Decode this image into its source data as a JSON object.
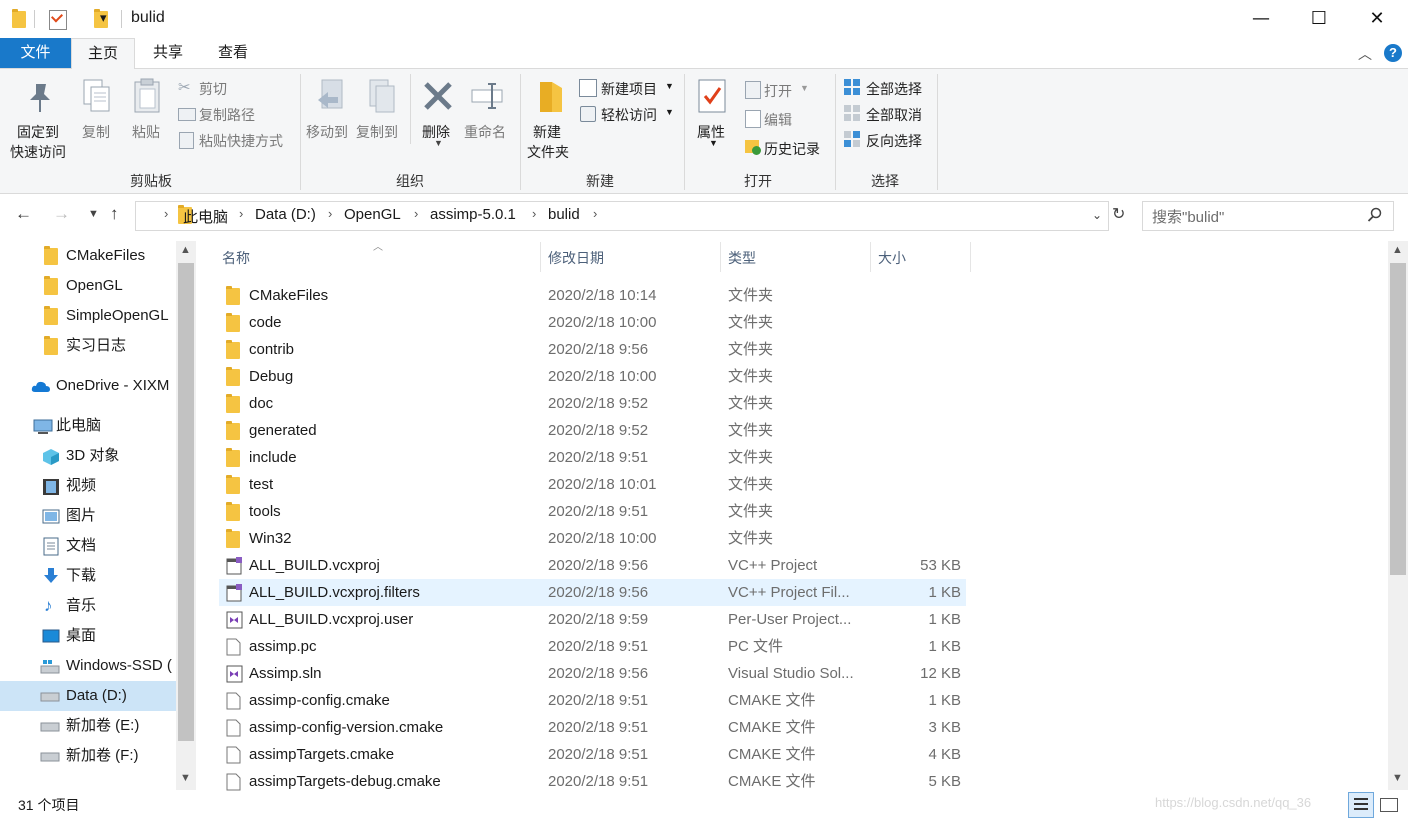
{
  "window": {
    "title": "bulid",
    "minimize": "—",
    "maximize": "☐",
    "close": "✕",
    "quick_access_dropdown": "▾"
  },
  "ribbon_tabs": [
    {
      "label": "文件"
    },
    {
      "label": "主页"
    },
    {
      "label": "共享"
    },
    {
      "label": "查看"
    }
  ],
  "ribbon": {
    "clipboard": {
      "pin_label_1": "固定到",
      "pin_label_2": "快速访问",
      "copy": "复制",
      "paste": "粘贴",
      "cut": "剪切",
      "copy_path": "复制路径",
      "paste_shortcut": "粘贴快捷方式",
      "group": "剪贴板"
    },
    "organize": {
      "move_to": "移动到",
      "copy_to": "复制到",
      "delete": "删除",
      "rename": "重命名",
      "group": "组织"
    },
    "new": {
      "new_folder_1": "新建",
      "new_folder_2": "文件夹",
      "new_item": "新建项目",
      "easy_access": "轻松访问",
      "group": "新建"
    },
    "open": {
      "properties": "属性",
      "open": "打开",
      "edit": "编辑",
      "history": "历史记录",
      "group": "打开"
    },
    "select": {
      "select_all": "全部选择",
      "select_none": "全部取消",
      "invert": "反向选择",
      "group": "选择"
    }
  },
  "address": {
    "crumbs": [
      "此电脑",
      "Data (D:)",
      "OpenGL",
      "assimp-5.0.1",
      "bulid"
    ],
    "search_placeholder": "搜索\"bulid\""
  },
  "nav": [
    {
      "label": "CMakeFiles",
      "icon": "folder-icon"
    },
    {
      "label": "OpenGL",
      "icon": "folder-icon"
    },
    {
      "label": "SimpleOpenGL",
      "icon": "folder-icon"
    },
    {
      "label": "实习日志",
      "icon": "folder-icon"
    },
    {
      "label": "OneDrive - XIXM",
      "icon": "onedrive-icon"
    },
    {
      "label": "此电脑",
      "icon": "pc-icon"
    },
    {
      "label": "3D 对象",
      "icon": "3d-objects-icon"
    },
    {
      "label": "视频",
      "icon": "video-icon"
    },
    {
      "label": "图片",
      "icon": "pictures-icon"
    },
    {
      "label": "文档",
      "icon": "documents-icon"
    },
    {
      "label": "下载",
      "icon": "download-icon"
    },
    {
      "label": "音乐",
      "icon": "music-icon"
    },
    {
      "label": "桌面",
      "icon": "desktop-icon"
    },
    {
      "label": "Windows-SSD (",
      "icon": "windows-drive-icon"
    },
    {
      "label": "Data (D:)",
      "icon": "drive-icon"
    },
    {
      "label": "新加卷 (E:)",
      "icon": "drive-icon"
    },
    {
      "label": "新加卷 (F:)",
      "icon": "drive-icon"
    }
  ],
  "columns": {
    "name": "名称",
    "date": "修改日期",
    "type": "类型",
    "size": "大小"
  },
  "files": [
    {
      "name": "CMakeFiles",
      "date": "2020/2/18 10:14",
      "type": "文件夹",
      "size": "",
      "icon": "folder-icon"
    },
    {
      "name": "code",
      "date": "2020/2/18 10:00",
      "type": "文件夹",
      "size": "",
      "icon": "folder-icon"
    },
    {
      "name": "contrib",
      "date": "2020/2/18 9:56",
      "type": "文件夹",
      "size": "",
      "icon": "folder-icon"
    },
    {
      "name": "Debug",
      "date": "2020/2/18 10:00",
      "type": "文件夹",
      "size": "",
      "icon": "folder-icon"
    },
    {
      "name": "doc",
      "date": "2020/2/18 9:52",
      "type": "文件夹",
      "size": "",
      "icon": "folder-icon"
    },
    {
      "name": "generated",
      "date": "2020/2/18 9:52",
      "type": "文件夹",
      "size": "",
      "icon": "folder-icon"
    },
    {
      "name": "include",
      "date": "2020/2/18 9:51",
      "type": "文件夹",
      "size": "",
      "icon": "folder-icon"
    },
    {
      "name": "test",
      "date": "2020/2/18 10:01",
      "type": "文件夹",
      "size": "",
      "icon": "folder-icon"
    },
    {
      "name": "tools",
      "date": "2020/2/18 9:51",
      "type": "文件夹",
      "size": "",
      "icon": "folder-icon"
    },
    {
      "name": "Win32",
      "date": "2020/2/18 10:00",
      "type": "文件夹",
      "size": "",
      "icon": "folder-icon"
    },
    {
      "name": "ALL_BUILD.vcxproj",
      "date": "2020/2/18 9:56",
      "type": "VC++ Project",
      "size": "53 KB",
      "icon": "vcxproj-icon"
    },
    {
      "name": "ALL_BUILD.vcxproj.filters",
      "date": "2020/2/18 9:56",
      "type": "VC++ Project Fil...",
      "size": "1 KB",
      "icon": "filters-icon"
    },
    {
      "name": "ALL_BUILD.vcxproj.user",
      "date": "2020/2/18 9:59",
      "type": "Per-User Project...",
      "size": "1 KB",
      "icon": "vs-user-icon"
    },
    {
      "name": "assimp.pc",
      "date": "2020/2/18 9:51",
      "type": "PC 文件",
      "size": "1 KB",
      "icon": "file-icon"
    },
    {
      "name": "Assimp.sln",
      "date": "2020/2/18 9:56",
      "type": "Visual Studio Sol...",
      "size": "12 KB",
      "icon": "sln-icon"
    },
    {
      "name": "assimp-config.cmake",
      "date": "2020/2/18 9:51",
      "type": "CMAKE 文件",
      "size": "1 KB",
      "icon": "file-icon"
    },
    {
      "name": "assimp-config-version.cmake",
      "date": "2020/2/18 9:51",
      "type": "CMAKE 文件",
      "size": "3 KB",
      "icon": "file-icon"
    },
    {
      "name": "assimpTargets.cmake",
      "date": "2020/2/18 9:51",
      "type": "CMAKE 文件",
      "size": "4 KB",
      "icon": "file-icon"
    },
    {
      "name": "assimpTargets-debug.cmake",
      "date": "2020/2/18 9:51",
      "type": "CMAKE 文件",
      "size": "5 KB",
      "icon": "file-icon"
    }
  ],
  "status": {
    "count": "31 个项目",
    "watermark": "https://blog.csdn.net/qq_36"
  },
  "colors": {
    "accent": "#1979ca",
    "selection": "#e5f3ff",
    "folder": "#f5c442"
  }
}
